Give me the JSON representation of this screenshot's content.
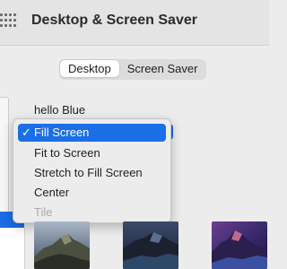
{
  "window": {
    "title": "Desktop & Screen Saver",
    "grid_icon": "show-all-grid-icon"
  },
  "tabs": [
    {
      "label": "Desktop",
      "selected": true
    },
    {
      "label": "Screen Saver",
      "selected": false
    }
  ],
  "picture_name": "hello Blue",
  "accent_color": "#1a6ee6",
  "fit_menu": {
    "items": [
      {
        "label": "Fill Screen",
        "checked": true,
        "highlighted": true,
        "enabled": true
      },
      {
        "label": "Fit to Screen",
        "checked": false,
        "highlighted": false,
        "enabled": true
      },
      {
        "label": "Stretch to Fill Screen",
        "checked": false,
        "highlighted": false,
        "enabled": true
      },
      {
        "label": "Center",
        "checked": false,
        "highlighted": false,
        "enabled": true
      },
      {
        "label": "Tile",
        "checked": false,
        "highlighted": false,
        "enabled": false
      }
    ],
    "checkmark": "✓"
  },
  "wallpapers": [
    {
      "name": "catalina-island-thumbnail"
    },
    {
      "name": "catalina-coast-thumbnail"
    },
    {
      "name": "catalina-dusk-thumbnail"
    }
  ]
}
